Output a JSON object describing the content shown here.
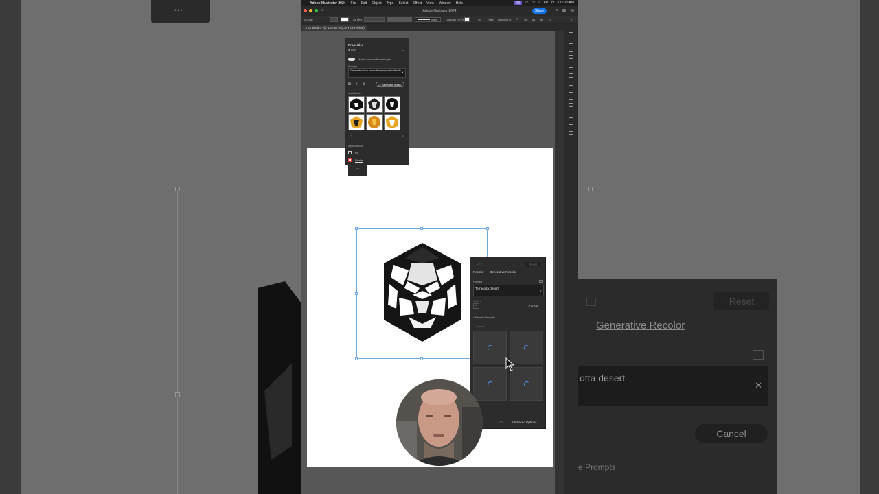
{
  "background": {
    "panel_tab": "Generative Recolor",
    "panel_reset": "Reset",
    "panel_prompt": "otta desert",
    "panel_cancel": "Cancel",
    "panel_sample": "e Prompts",
    "top_card": "•••"
  },
  "menubar": {
    "app_name": "Adobe Illustrator 2024",
    "items": [
      "File",
      "Edit",
      "Object",
      "Type",
      "Select",
      "Effect",
      "View",
      "Window",
      "Help"
    ],
    "clock": "Fri Oct 13  11:20 AM"
  },
  "window": {
    "title": "Adobe Illustrator 2024",
    "share_label": "Share",
    "doc_tab": "Untitled-1* @ 129.98 % (CMYK/Preview)"
  },
  "control_bar": {
    "selection": "Group",
    "stroke_label": "Stroke:",
    "stroke_style": "Basic",
    "opacity_label": "Opacity",
    "style_label": "Style:",
    "align_label": "Align",
    "transform_label": "Transform"
  },
  "properties_panel": {
    "title": "Properties",
    "type_select": "Icon",
    "toggle_label": "Match active artboard style",
    "prompt_label": "Prompt",
    "prompt_text": "Geometric lion face with minimalist details",
    "generate_label": "Generate (Beta)",
    "variations_label": "Variations",
    "appearance_label": "Appearance",
    "fill_label": "Fill",
    "stroke_label": "Stroke",
    "more_label": "•••",
    "collapse_label": "•••"
  },
  "recolor_panel": {
    "reset_label": "Reset",
    "tabs": [
      "Recolor",
      "Generative Recolor"
    ],
    "prompt_label": "Prompt",
    "prompt_text": "Terracotta desert",
    "colors_label": "Colors",
    "cancel_label": "Cancel",
    "sample_prompts_label": "Sample Prompts",
    "variations_label": "Variations",
    "advanced_label": "Advanced Options..."
  },
  "colors": {
    "accent": "#1473e6",
    "selection": "#6fa8dc",
    "spinner": "#4a90e2",
    "lion_gold": "#e8a321"
  }
}
